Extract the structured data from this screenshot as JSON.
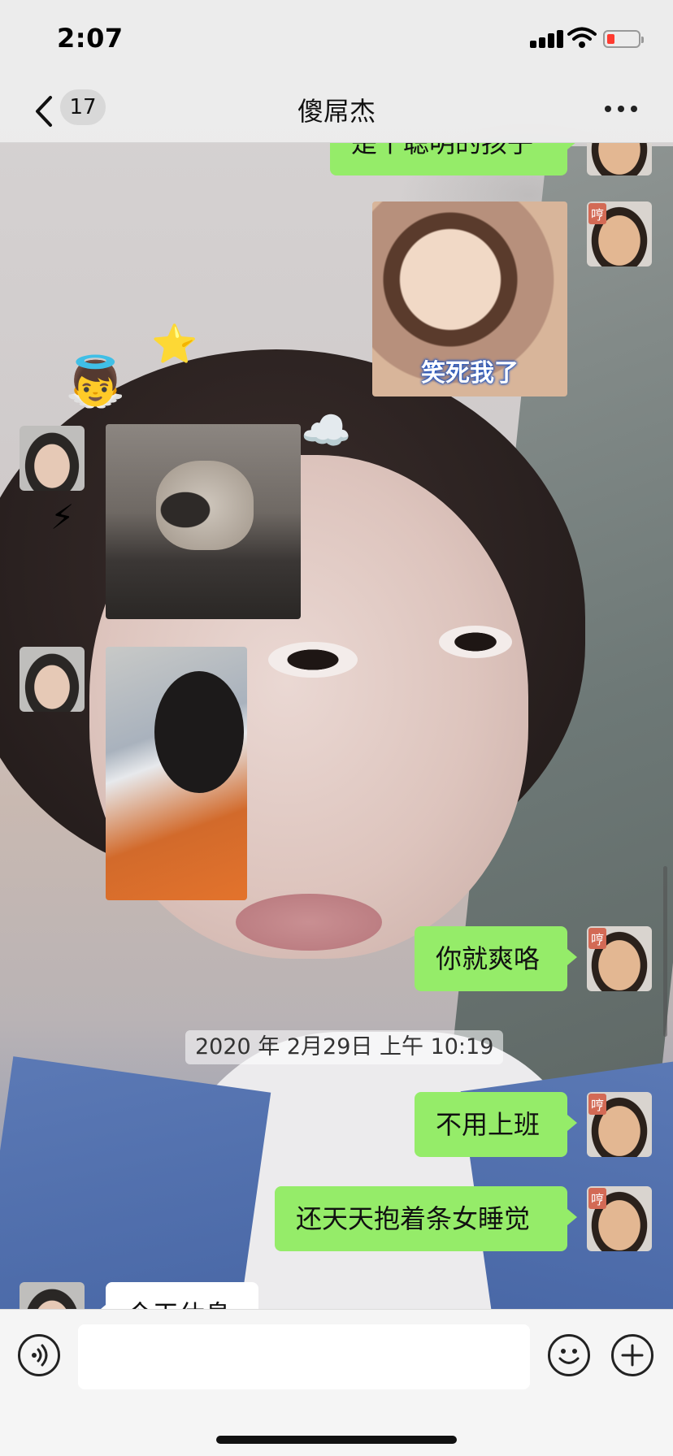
{
  "status_bar": {
    "time": "2:07"
  },
  "nav": {
    "unread_badge": "17",
    "title": "傻屌杰"
  },
  "messages": [
    {
      "side": "me",
      "type": "text",
      "text": "是个聪明的孩子"
    },
    {
      "side": "me",
      "type": "image",
      "caption": "笑死我了"
    },
    {
      "side": "them",
      "type": "image"
    },
    {
      "side": "them",
      "type": "image"
    },
    {
      "side": "me",
      "type": "text",
      "text": "你就爽咯"
    },
    {
      "side": "system",
      "type": "timestamp",
      "text": "2020 年 2月29日 上午 10:19"
    },
    {
      "side": "me",
      "type": "text",
      "text": "不用上班"
    },
    {
      "side": "me",
      "type": "text",
      "text": "还天天抱着条女睡觉"
    },
    {
      "side": "them",
      "type": "text",
      "text": "今天休息"
    }
  ],
  "avatar_tag": "哼",
  "input_bar": {
    "placeholder": ""
  },
  "colors": {
    "my_bubble": "#95ec69",
    "their_bubble": "#ffffff",
    "battery_low": "#ff3b30"
  },
  "icons": [
    "back-chevron-icon",
    "more-icon",
    "voice-icon",
    "emoji-icon",
    "plus-icon",
    "signal-icon",
    "wifi-icon",
    "battery-icon"
  ]
}
